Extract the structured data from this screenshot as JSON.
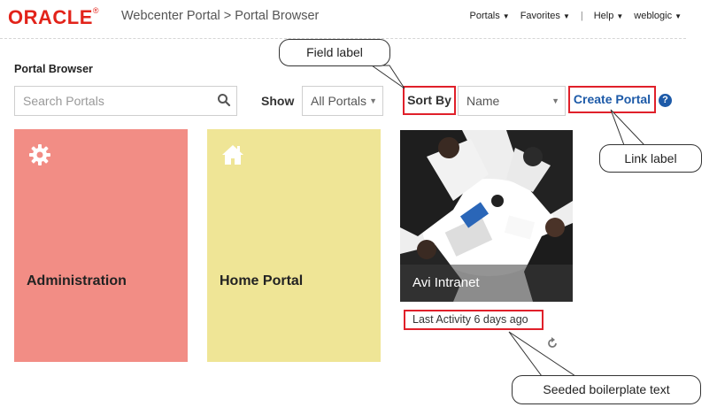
{
  "header": {
    "logo": "ORACLE",
    "registered": "®",
    "title": "Webcenter Portal > Portal Browser",
    "nav": [
      {
        "label": "Portals",
        "caret": "▼"
      },
      {
        "label": "Favorites",
        "caret": "▼"
      },
      {
        "separator": "|"
      },
      {
        "label": "Help",
        "caret": "▼"
      },
      {
        "label": "weblogic",
        "caret": "▼"
      }
    ]
  },
  "page": {
    "title": "Portal Browser"
  },
  "search": {
    "placeholder": "Search Portals",
    "icon": "search-icon"
  },
  "filters": {
    "show_label": "Show",
    "show_value": "All Portals",
    "sort_label": "Sort By",
    "sort_value": "Name",
    "create_label": "Create Portal",
    "help_glyph": "?"
  },
  "tiles": [
    {
      "label": "Administration",
      "icon": "gear-icon",
      "color": "#f28d85"
    },
    {
      "label": "Home Portal",
      "icon": "home-icon",
      "color": "#efe596"
    },
    {
      "label": "Avi Intranet",
      "icon": "photo"
    }
  ],
  "activity": {
    "text": "Last Activity 6 days ago"
  },
  "callouts": {
    "field": "Field label",
    "link": "Link label",
    "seeded": "Seeded boilerplate text"
  },
  "colors": {
    "highlight": "#e0202a",
    "link": "#1d5aa8",
    "brand": "#e2231a"
  }
}
